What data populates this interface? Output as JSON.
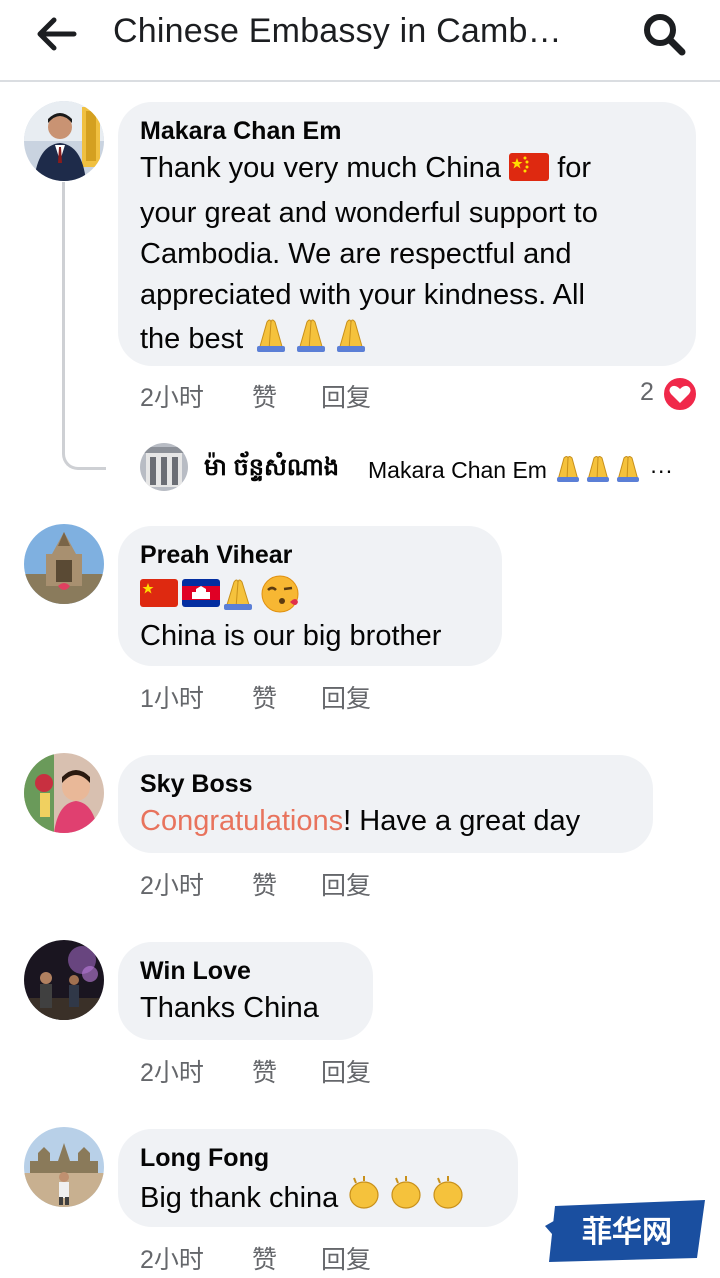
{
  "header": {
    "title": "Chinese Embassy in Camb…",
    "back_icon": "arrow-left-icon",
    "search_icon": "search-icon"
  },
  "comments": [
    {
      "author": "Makara Chan Em",
      "text_lines": [
        "Thank you very much China",
        "for",
        "your great and wonderful support to",
        "Cambodia. We are respectful and",
        "appreciated with your kindness. All",
        "the best"
      ],
      "time": "2小时",
      "like": "赞",
      "reply": "回复",
      "reaction_count": "2",
      "reply_preview": {
        "name": "ម៉ា ច័ន្ទសំណាង",
        "text": "Makara Chan Em",
        "more": "···"
      }
    },
    {
      "author": "Preah Vihear",
      "text": "China is our big brother",
      "time": "1小时",
      "like": "赞",
      "reply": "回复"
    },
    {
      "author": "Sky Boss",
      "text_highlight": "Congratulations",
      "text_rest": "! Have a great day",
      "time": "2小时",
      "like": "赞",
      "reply": "回复"
    },
    {
      "author": "Win Love",
      "text": "Thanks China",
      "time": "2小时",
      "like": "赞",
      "reply": "回复"
    },
    {
      "author": "Long Fong",
      "text": "Big thank china",
      "time": "2小时",
      "like": "赞",
      "reply": "回复"
    }
  ],
  "watermark": {
    "text": "菲华网"
  },
  "colors": {
    "bubble": "#f0f2f5",
    "meta": "#65676b",
    "highlight": "#e8735d",
    "heart": "#f0284a"
  }
}
